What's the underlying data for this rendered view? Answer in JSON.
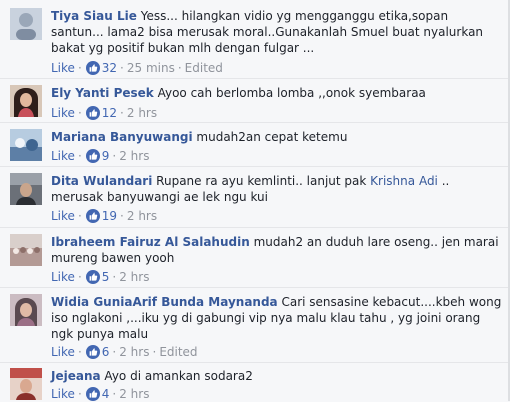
{
  "comments": [
    {
      "author": "Tiya Siau Lie",
      "text": "Yess... hilangkan vidio yg mengganggu etika,sopan santun... lama2 bisa merusak moral..Gunakanlah Smuel buat nyalurkan bakat yg positif bukan mlh dengan fulgar ...",
      "like_label": "Like",
      "reaction_icon": "thumbs-up-icon",
      "likes": "32",
      "time": "25 mins",
      "edited": "Edited",
      "avatar_color": "#9aa7b8"
    },
    {
      "author": "Ely Yanti Pesek",
      "text": "Ayoo cah berlomba lomba ,,onok syembaraa",
      "like_label": "Like",
      "reaction_icon": "thumbs-up-icon",
      "likes": "12",
      "time": "2 hrs",
      "avatar_color": "#5d3b33"
    },
    {
      "author": "Mariana Banyuwangi",
      "text": "mudah2an cepat ketemu",
      "like_label": "Like",
      "reaction_icon": "thumbs-up-icon",
      "likes": "9",
      "time": "2 hrs",
      "avatar_color": "#6a8fb5"
    },
    {
      "author": "Dita Wulandari",
      "text_before": "Rupane ra ayu kemlinti.. lanjut pak ",
      "mention": "Krishna Adi",
      "text_after": " .. merusak banyuwangi ae lek ngu kui",
      "like_label": "Like",
      "reaction_icon": "thumbs-up-icon",
      "likes": "19",
      "time": "2 hrs",
      "avatar_color": "#4a4f57"
    },
    {
      "author": "Ibraheem Fairuz Al Salahudin",
      "text": "mudah2 an duduh lare oseng.. jen marai mureng bawen yooh",
      "like_label": "Like",
      "reaction_icon": "thumbs-up-icon",
      "likes": "5",
      "time": "2 hrs",
      "avatar_color": "#b9a6a0"
    },
    {
      "author": "Widia GuniaArif Bunda Maynanda",
      "text": "Cari sensasine kebacut....kbeh wong iso nglakoni ,...iku yg di gabungi vip nya malu klau tahu , yg joini orang ngk punya malu",
      "like_label": "Like",
      "reaction_icon": "thumbs-up-icon",
      "likes": "6",
      "time": "2 hrs",
      "edited": "Edited",
      "avatar_color": "#8c7b83"
    },
    {
      "author": "Jejeana",
      "text": "Ayo di amankan sodara2",
      "like_label": "Like",
      "reaction_icon": "thumbs-up-icon",
      "likes": "4",
      "time": "2 hrs",
      "avatar_color": "#c0504a"
    }
  ],
  "colors": {
    "author": "#365899",
    "action": "#4267b2",
    "meta": "#90949c",
    "background": "#f6f7f9"
  }
}
